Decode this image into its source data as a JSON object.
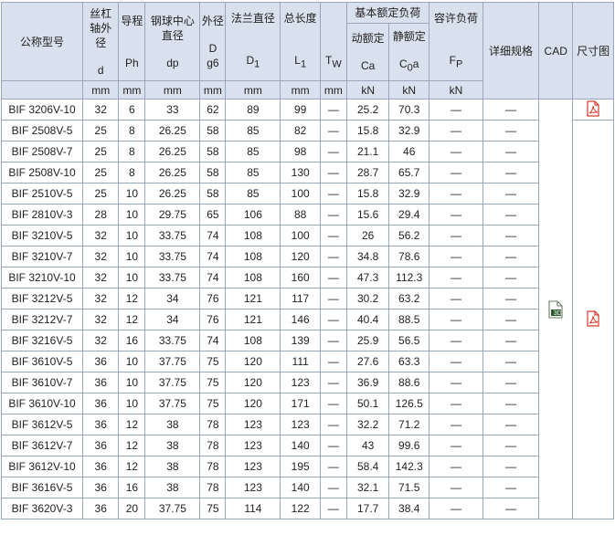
{
  "headers": {
    "model": "公称型号",
    "d_title": "丝杠轴外径",
    "d_sym": "d",
    "ph_title": "导程",
    "ph_sym": "Ph",
    "dp_title": "钢球中心直径",
    "dp_sym": "dp",
    "D_title": "外径",
    "D_sym": "D",
    "D_sym2": "g6",
    "d1_title": "法兰直径",
    "d1_sym": "D",
    "d1_sub": "1",
    "l1_title": "总长度",
    "l1_sym": "L",
    "l1_sub": "1",
    "tw_sym": "T",
    "tw_sub": "W",
    "load_title": "基本额定负荷",
    "ca_title": "动额定",
    "ca_sym": "Ca",
    "c0a_title": "静额定",
    "c0a_sym_pre": "C",
    "c0a_sub": "0",
    "c0a_sym_post": "a",
    "fp_title": "容许负荷",
    "fp_sym": "F",
    "fp_sub": "P",
    "detail": "详细规格",
    "cad": "CAD",
    "dim": "尺寸图"
  },
  "units": [
    "mm",
    "mm",
    "mm",
    "mm",
    "mm",
    "mm",
    "mm",
    "kN",
    "kN",
    "kN"
  ],
  "rows": [
    [
      "BIF 3206V-10",
      "32",
      "6",
      "33",
      "62",
      "89",
      "99",
      "—",
      "25.2",
      "70.3",
      "—",
      "—"
    ],
    [
      "BIF 2508V-5",
      "25",
      "8",
      "26.25",
      "58",
      "85",
      "82",
      "—",
      "15.8",
      "32.9",
      "—",
      "—"
    ],
    [
      "BIF 2508V-7",
      "25",
      "8",
      "26.25",
      "58",
      "85",
      "98",
      "—",
      "21.1",
      "46",
      "—",
      "—"
    ],
    [
      "BIF 2508V-10",
      "25",
      "8",
      "26.25",
      "58",
      "85",
      "130",
      "—",
      "28.7",
      "65.7",
      "—",
      "—"
    ],
    [
      "BIF 2510V-5",
      "25",
      "10",
      "26.25",
      "58",
      "85",
      "100",
      "—",
      "15.8",
      "32.9",
      "—",
      "—"
    ],
    [
      "BIF 2810V-3",
      "28",
      "10",
      "29.75",
      "65",
      "106",
      "88",
      "—",
      "15.6",
      "29.4",
      "—",
      "—"
    ],
    [
      "BIF 3210V-5",
      "32",
      "10",
      "33.75",
      "74",
      "108",
      "100",
      "—",
      "26",
      "56.2",
      "—",
      "—"
    ],
    [
      "BIF 3210V-7",
      "32",
      "10",
      "33.75",
      "74",
      "108",
      "120",
      "—",
      "34.8",
      "78.6",
      "—",
      "—"
    ],
    [
      "BIF 3210V-10",
      "32",
      "10",
      "33.75",
      "74",
      "108",
      "160",
      "—",
      "47.3",
      "112.3",
      "—",
      "—"
    ],
    [
      "BIF 3212V-5",
      "32",
      "12",
      "34",
      "76",
      "121",
      "117",
      "—",
      "30.2",
      "63.2",
      "—",
      "—"
    ],
    [
      "BIF 3212V-7",
      "32",
      "12",
      "34",
      "76",
      "121",
      "146",
      "—",
      "40.4",
      "88.5",
      "—",
      "—"
    ],
    [
      "BIF 3216V-5",
      "32",
      "16",
      "33.75",
      "74",
      "108",
      "139",
      "—",
      "25.9",
      "56.5",
      "—",
      "—"
    ],
    [
      "BIF 3610V-5",
      "36",
      "10",
      "37.75",
      "75",
      "120",
      "111",
      "—",
      "27.6",
      "63.3",
      "—",
      "—"
    ],
    [
      "BIF 3610V-7",
      "36",
      "10",
      "37.75",
      "75",
      "120",
      "123",
      "—",
      "36.9",
      "88.6",
      "—",
      "—"
    ],
    [
      "BIF 3610V-10",
      "36",
      "10",
      "37.75",
      "75",
      "120",
      "171",
      "—",
      "50.1",
      "126.5",
      "—",
      "—"
    ],
    [
      "BIF 3612V-5",
      "36",
      "12",
      "38",
      "78",
      "123",
      "123",
      "—",
      "32.2",
      "71.2",
      "—",
      "—"
    ],
    [
      "BIF 3612V-7",
      "36",
      "12",
      "38",
      "78",
      "123",
      "140",
      "—",
      "43",
      "99.6",
      "—",
      "—"
    ],
    [
      "BIF 3612V-10",
      "36",
      "12",
      "38",
      "78",
      "123",
      "195",
      "—",
      "58.4",
      "142.3",
      "—",
      "—"
    ],
    [
      "BIF 3616V-5",
      "36",
      "16",
      "38",
      "78",
      "123",
      "140",
      "—",
      "32.1",
      "71.5",
      "—",
      "—"
    ],
    [
      "BIF 3620V-3",
      "36",
      "20",
      "37.75",
      "75",
      "114",
      "122",
      "—",
      "17.7",
      "38.4",
      "—",
      "—"
    ]
  ],
  "icons": {
    "pdf_icon": "pdf-file-icon",
    "cad_icon": "cad-3d-file-icon",
    "cad_label": "3D",
    "pdf_color": "#d93a2b"
  }
}
